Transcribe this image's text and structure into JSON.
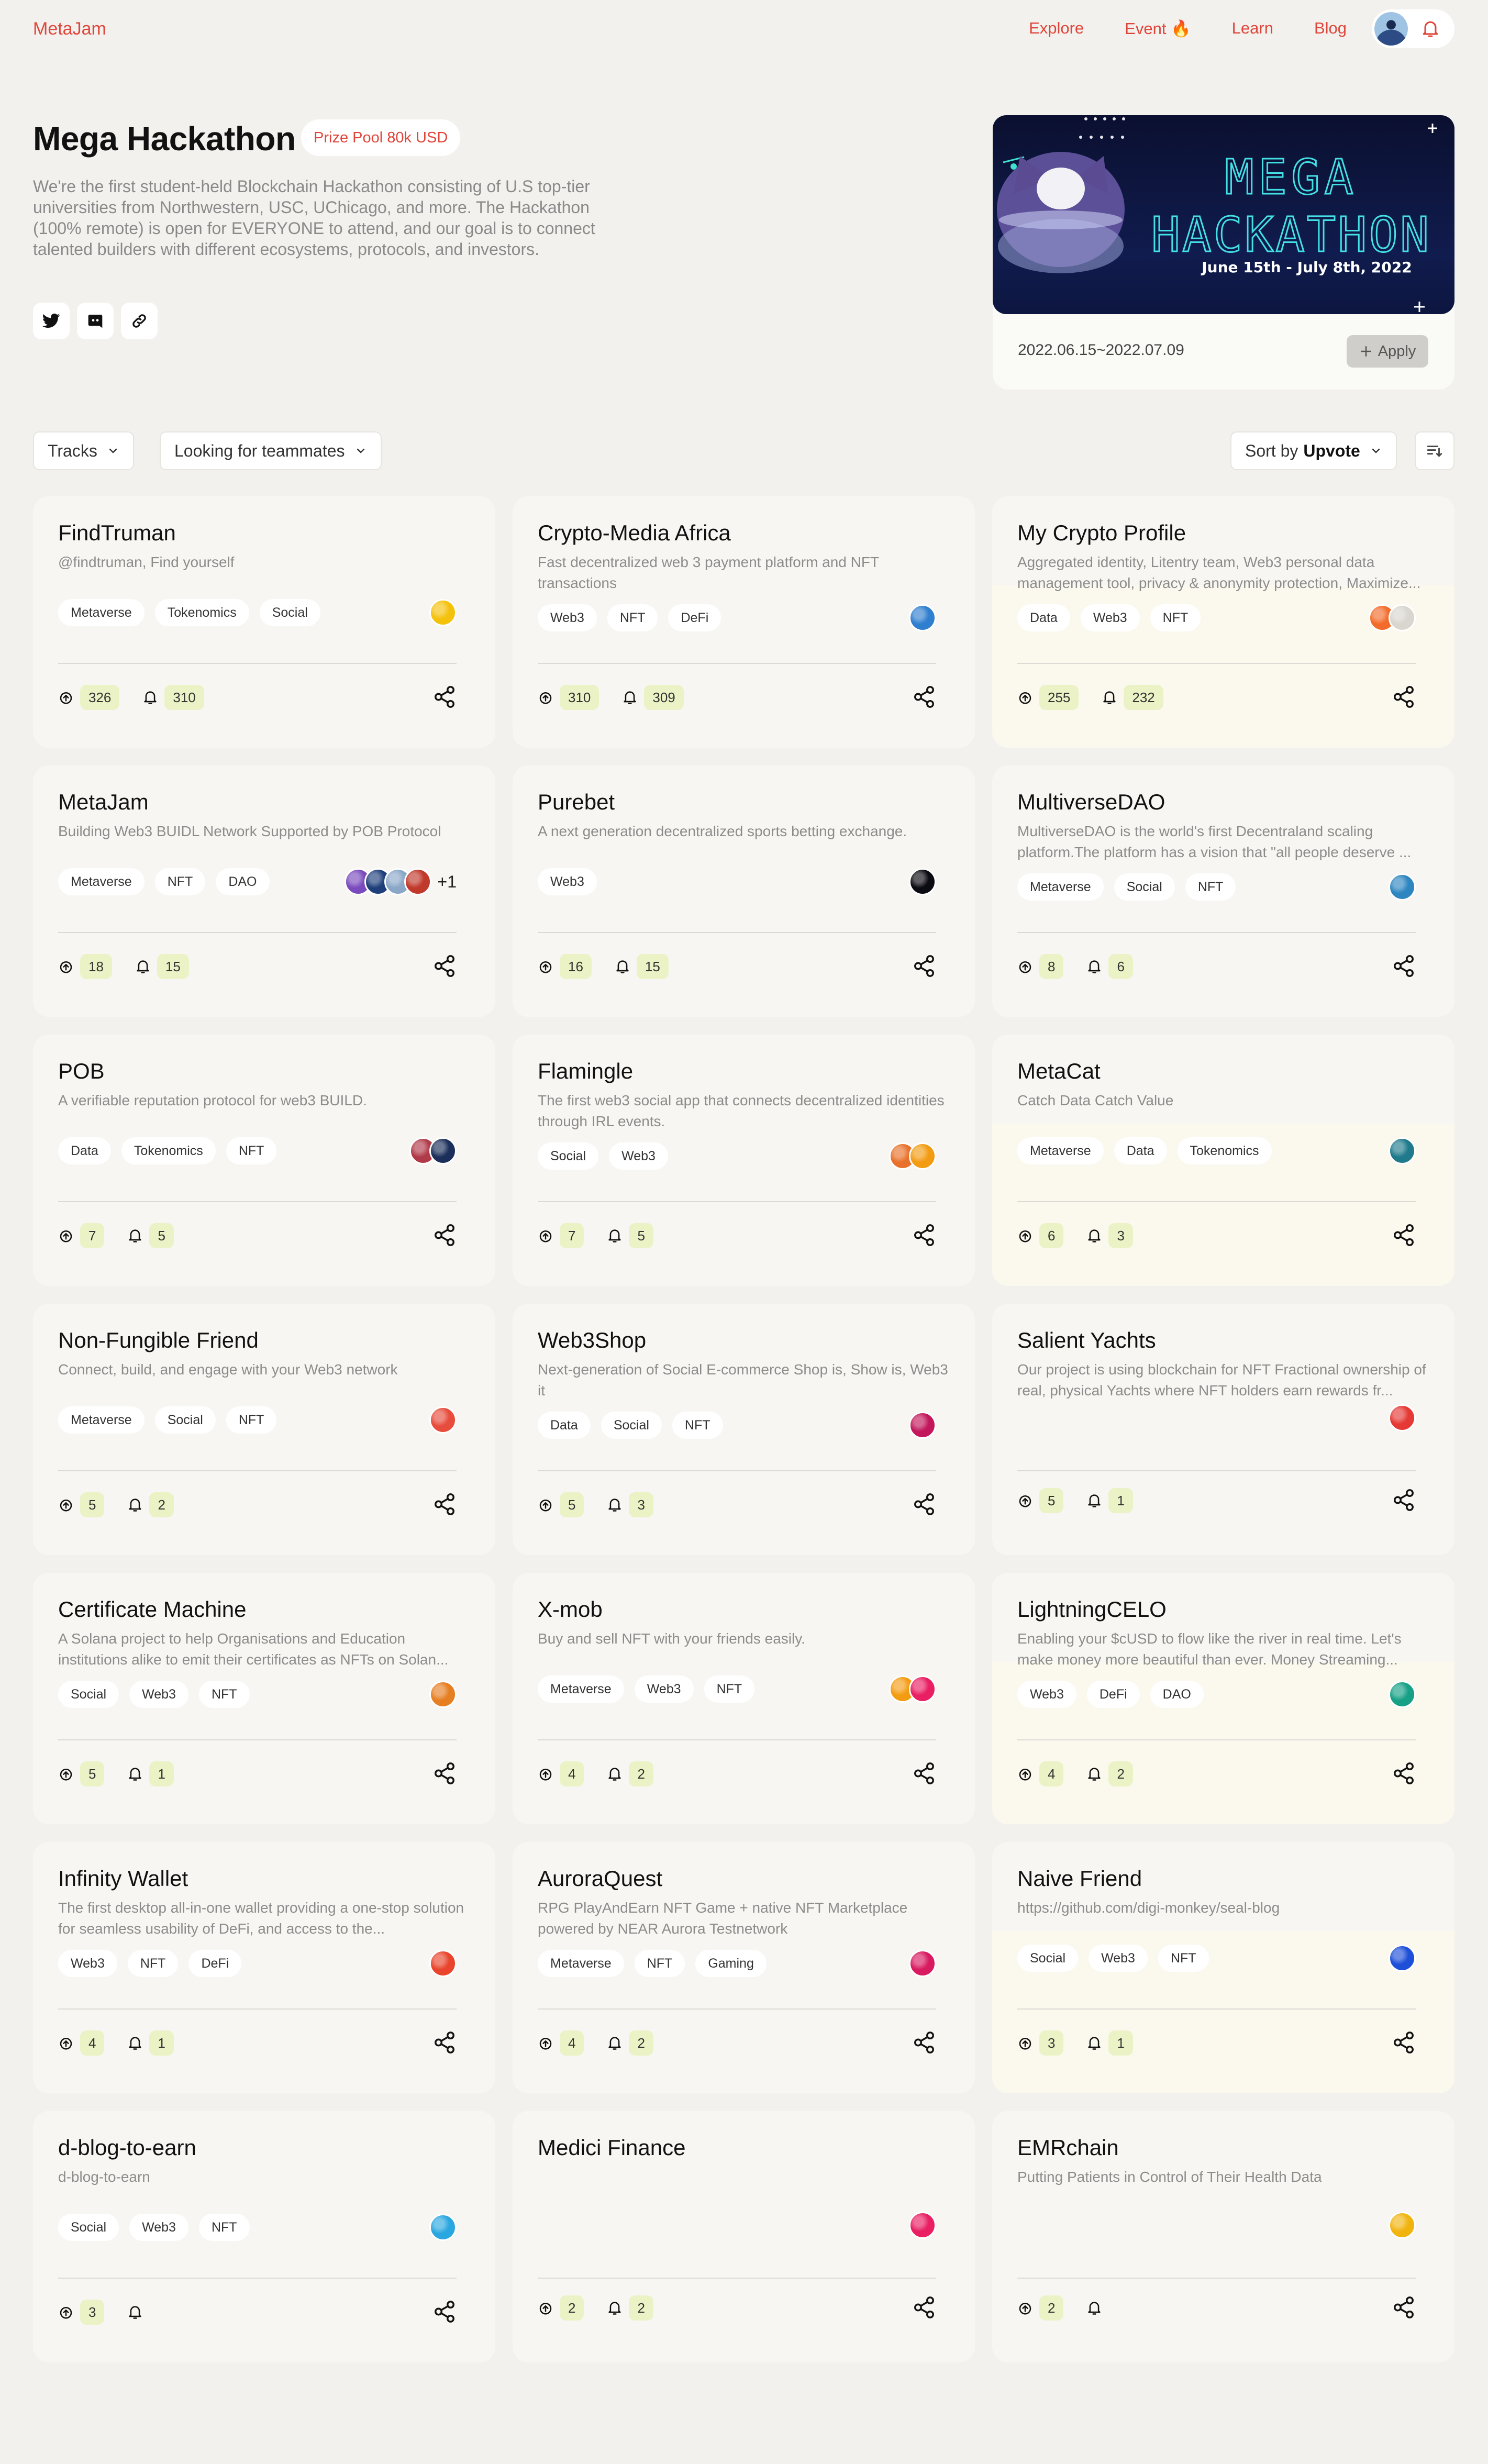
{
  "nav": {
    "brand": "MetaJam",
    "links": [
      "Explore",
      "Event 🔥",
      "Learn",
      "Blog"
    ]
  },
  "hero": {
    "title": "Mega Hackathon",
    "prize": "Prize Pool 80k USD",
    "description": "We're the first student-held Blockchain Hackathon consisting of U.S top-tier universities from Northwestern, USC, UChicago, and more. The Hackathon (100% remote) is open for EVERYONE to attend, and our goal is to connect talented builders with different ecosystems, protocols, and investors.",
    "banner_line1": "MEGA",
    "banner_line2": "HACKATHON",
    "banner_dates": "June 15th - July 8th, 2022",
    "date_range": "2022.06.15~2022.07.09",
    "apply_label": "Apply"
  },
  "filters": {
    "tracks": "Tracks",
    "teammates": "Looking for teammates",
    "sort_prefix": "Sort by",
    "sort_value": "Upvote"
  },
  "projects": [
    {
      "title": "FindTruman",
      "desc": "@findtruman, Find yourself",
      "tags": [
        "Metaverse",
        "Tokenomics",
        "Social"
      ],
      "avatars": [
        "#f4c20d"
      ],
      "more": "",
      "upvotes": "326",
      "follows": "310",
      "light": false
    },
    {
      "title": "Crypto-Media Africa",
      "desc": "Fast decentralized web 3 payment platform and NFT transactions",
      "tags": [
        "Web3",
        "NFT",
        "DeFi"
      ],
      "avatars": [
        "#2f7fcf"
      ],
      "more": "",
      "upvotes": "310",
      "follows": "309",
      "light": false
    },
    {
      "title": "My Crypto Profile",
      "desc": "Aggregated identity, Litentry team, Web3 personal data management tool, privacy & anonymity protection, Maximize...",
      "tags": [
        "Data",
        "Web3",
        "NFT"
      ],
      "avatars": [
        "#f26b2a",
        "#d9d6cf"
      ],
      "more": "",
      "upvotes": "255",
      "follows": "232",
      "light": true
    },
    {
      "title": "MetaJam",
      "desc": "Building Web3 BUIDL Network Supported by POB Protocol",
      "tags": [
        "Metaverse",
        "NFT",
        "DAO"
      ],
      "avatars": [
        "#7a4bbd",
        "#1e3f7a",
        "#8aa7c8",
        "#c0392b"
      ],
      "more": "+1",
      "upvotes": "18",
      "follows": "15",
      "light": false
    },
    {
      "title": "Purebet",
      "desc": "A next generation decentralized sports betting exchange.",
      "tags": [
        "Web3"
      ],
      "avatars": [
        "#0b0b12"
      ],
      "more": "",
      "upvotes": "16",
      "follows": "15",
      "light": false
    },
    {
      "title": "MultiverseDAO",
      "desc": "MultiverseDAO is the world's first Decentraland scaling platform.The platform has a vision that \"all people deserve ...",
      "tags": [
        "Metaverse",
        "Social",
        "NFT"
      ],
      "avatars": [
        "#2e86c1"
      ],
      "more": "",
      "upvotes": "8",
      "follows": "6",
      "light": false
    },
    {
      "title": "POB",
      "desc": "A verifiable reputation protocol for web3 BUILD.",
      "tags": [
        "Data",
        "Tokenomics",
        "NFT"
      ],
      "avatars": [
        "#b03a48",
        "#1c2f5a"
      ],
      "more": "",
      "upvotes": "7",
      "follows": "5",
      "light": false
    },
    {
      "title": "Flamingle",
      "desc": "The first web3 social app that connects decentralized identities through IRL events.",
      "tags": [
        "Social",
        "Web3"
      ],
      "avatars": [
        "#e8712b",
        "#f39c12"
      ],
      "more": "",
      "upvotes": "7",
      "follows": "5",
      "light": false
    },
    {
      "title": "MetaCat",
      "desc": "Catch Data Catch Value",
      "tags": [
        "Metaverse",
        "Data",
        "Tokenomics"
      ],
      "avatars": [
        "#1f7a8c"
      ],
      "more": "",
      "upvotes": "6",
      "follows": "3",
      "light": true
    },
    {
      "title": "Non-Fungible Friend",
      "desc": "Connect, build, and engage with your Web3 network",
      "tags": [
        "Metaverse",
        "Social",
        "NFT"
      ],
      "avatars": [
        "#e74c3c"
      ],
      "more": "",
      "upvotes": "5",
      "follows": "2",
      "light": false
    },
    {
      "title": "Web3Shop",
      "desc": "Next-generation of Social E-commerce Shop is, Show is, Web3 it",
      "tags": [
        "Data",
        "Social",
        "NFT"
      ],
      "avatars": [
        "#c2185b"
      ],
      "more": "",
      "upvotes": "5",
      "follows": "3",
      "light": false
    },
    {
      "title": "Salient Yachts",
      "desc": "Our project is using blockchain for NFT Fractional ownership of real, physical Yachts where NFT holders earn rewards fr...",
      "tags": [],
      "avatars": [
        "#e53935"
      ],
      "more": "",
      "upvotes": "5",
      "follows": "1",
      "light": false
    },
    {
      "title": "Certificate Machine",
      "desc": "A Solana project to help Organisations and Education institutions alike to emit their certificates as NFTs on Solan...",
      "tags": [
        "Social",
        "Web3",
        "NFT"
      ],
      "avatars": [
        "#e67e22"
      ],
      "more": "",
      "upvotes": "5",
      "follows": "1",
      "light": false
    },
    {
      "title": "X-mob",
      "desc": "Buy and sell NFT with your friends easily.",
      "tags": [
        "Metaverse",
        "Web3",
        "NFT"
      ],
      "avatars": [
        "#f39c12",
        "#e91e63"
      ],
      "more": "",
      "upvotes": "4",
      "follows": "2",
      "light": false
    },
    {
      "title": "LightningCELO",
      "desc": "Enabling your $cUSD to flow like the river in real time. Let's make money more beautiful than ever. Money Streaming...",
      "tags": [
        "Web3",
        "DeFi",
        "DAO"
      ],
      "avatars": [
        "#16a085"
      ],
      "more": "",
      "upvotes": "4",
      "follows": "2",
      "light": true
    },
    {
      "title": "Infinity Wallet",
      "desc": "The first desktop all-in-one wallet providing a one-stop solution for seamless usability of DeFi, and access to the...",
      "tags": [
        "Web3",
        "NFT",
        "DeFi"
      ],
      "avatars": [
        "#e8452c"
      ],
      "more": "",
      "upvotes": "4",
      "follows": "1",
      "light": false
    },
    {
      "title": "AuroraQuest",
      "desc": "RPG PlayAndEarn NFT Game + native NFT Marketplace powered by NEAR Aurora Testnetwork",
      "tags": [
        "Metaverse",
        "NFT",
        "Gaming"
      ],
      "avatars": [
        "#d81b60"
      ],
      "more": "",
      "upvotes": "4",
      "follows": "2",
      "light": false
    },
    {
      "title": "Naive Friend",
      "desc": "https://github.com/digi-monkey/seal-blog",
      "tags": [
        "Social",
        "Web3",
        "NFT"
      ],
      "avatars": [
        "#1e4fd8"
      ],
      "more": "",
      "upvotes": "3",
      "follows": "1",
      "light": true
    },
    {
      "title": "d-blog-to-earn",
      "desc": "d-blog-to-earn",
      "tags": [
        "Social",
        "Web3",
        "NFT"
      ],
      "avatars": [
        "#2aa7e0"
      ],
      "more": "",
      "upvotes": "3",
      "follows": "",
      "light": false
    },
    {
      "title": "Medici Finance",
      "desc": "",
      "tags": [],
      "avatars": [
        "#e91e63"
      ],
      "more": "",
      "upvotes": "2",
      "follows": "2",
      "light": false
    },
    {
      "title": "EMRchain",
      "desc": "Putting Patients in Control of Their Health Data",
      "tags": [],
      "avatars": [
        "#f1b40f"
      ],
      "more": "",
      "upvotes": "2",
      "follows": "",
      "light": false
    }
  ]
}
